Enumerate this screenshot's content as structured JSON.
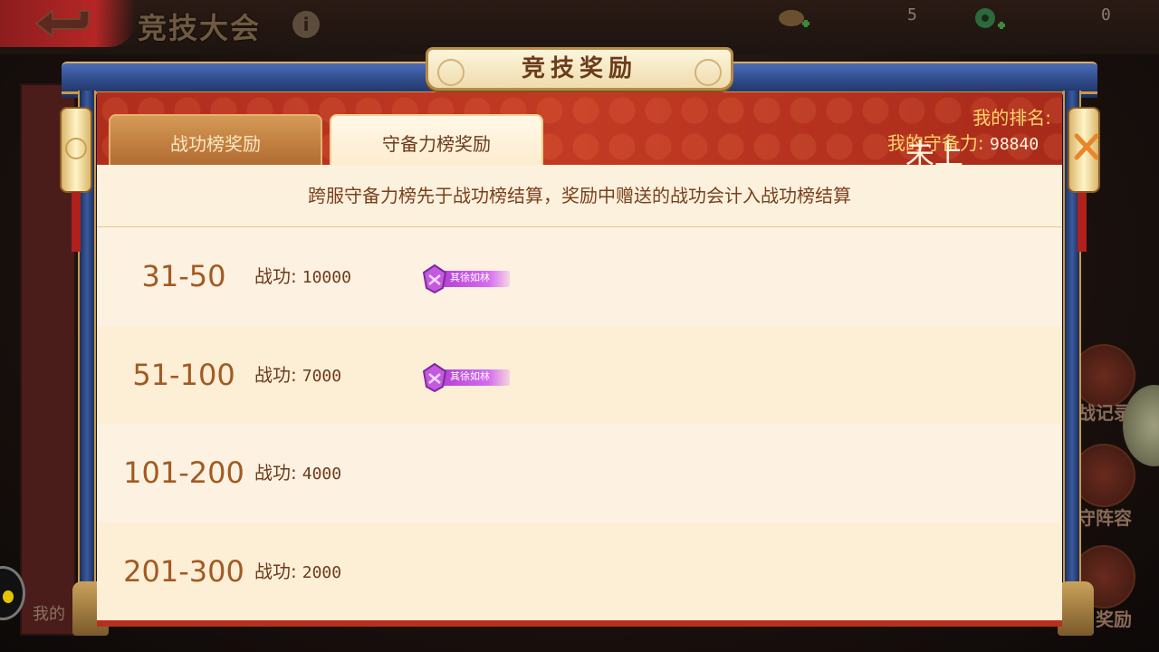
{
  "background": {
    "title": "竞技大会",
    "info_icon": "i",
    "resources": [
      {
        "icon": "scroll-token-icon",
        "value": "5"
      },
      {
        "icon": "jade-token-icon",
        "value": "0"
      }
    ],
    "left_label": "我的",
    "right_labels": [
      "战记录",
      "守阵容",
      "奖励"
    ]
  },
  "modal": {
    "title": "竞技奖励",
    "tabs": [
      {
        "label": "战功榜奖励",
        "active": false
      },
      {
        "label": "守备力榜奖励",
        "active": true
      }
    ],
    "my_rank_label": "我的排名:",
    "my_rank_value": "未上榜",
    "my_power_label": "我的守备力:",
    "my_power_value": "98840",
    "notice": "跨服守备力榜先于战功榜结算，奖励中赠送的战功会计入战功榜结算",
    "reward_rows": [
      {
        "rank": "31-50",
        "reward_label": "战功:",
        "reward_value": "10000",
        "badge": "其徐如林"
      },
      {
        "rank": "51-100",
        "reward_label": "战功:",
        "reward_value": "7000",
        "badge": "其徐如林"
      },
      {
        "rank": "101-200",
        "reward_label": "战功:",
        "reward_value": "4000",
        "badge": ""
      },
      {
        "rank": "201-300",
        "reward_label": "战功:",
        "reward_value": "2000",
        "badge": ""
      }
    ]
  },
  "colors": {
    "frame_blue": "#2b4480",
    "header_red": "#b5301e",
    "gold": "#ffd36a",
    "rank_brown": "#a25a22",
    "badge_purple": "#c35ae0"
  }
}
